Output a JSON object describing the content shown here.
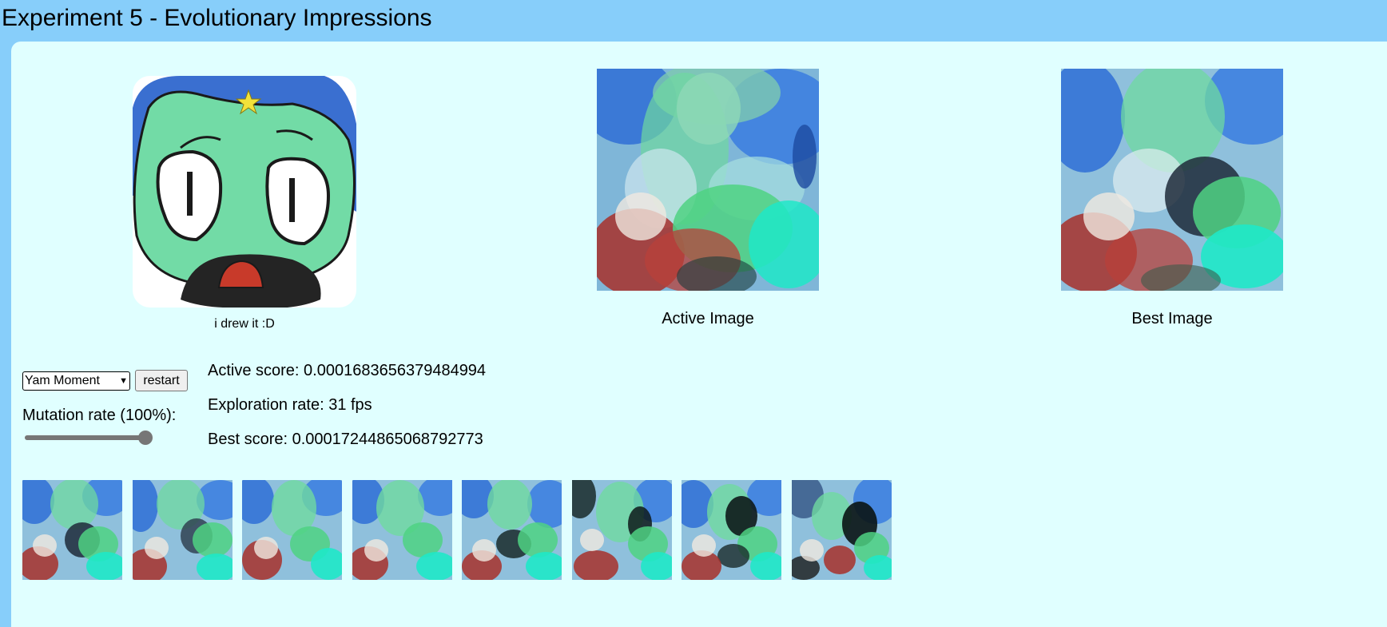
{
  "header": {
    "title": "Experiment 5 - Evolutionary Impressions"
  },
  "gallery": {
    "target_caption": "i drew it :D",
    "active_caption": "Active Image",
    "best_caption": "Best Image"
  },
  "controls": {
    "image_select": {
      "value": "Yam Moment",
      "icon": "chevron-down-icon"
    },
    "restart_label": "restart",
    "mutation_label": "Mutation rate (100%):",
    "mutation_value": 1.0
  },
  "stats": {
    "active": "Active score: 0.0001683656379484994",
    "exploration": "Exploration rate: 31 fps",
    "best": "Best score: 0.00017244865068792773"
  },
  "colors": {
    "page_bg": "#87cefa",
    "panel_bg": "#e0ffff",
    "mint": "#6fd9a0",
    "blue": "#2f6fd6",
    "red": "#a8302a",
    "cyan": "#1fe8c8"
  },
  "candidates_count": 8
}
